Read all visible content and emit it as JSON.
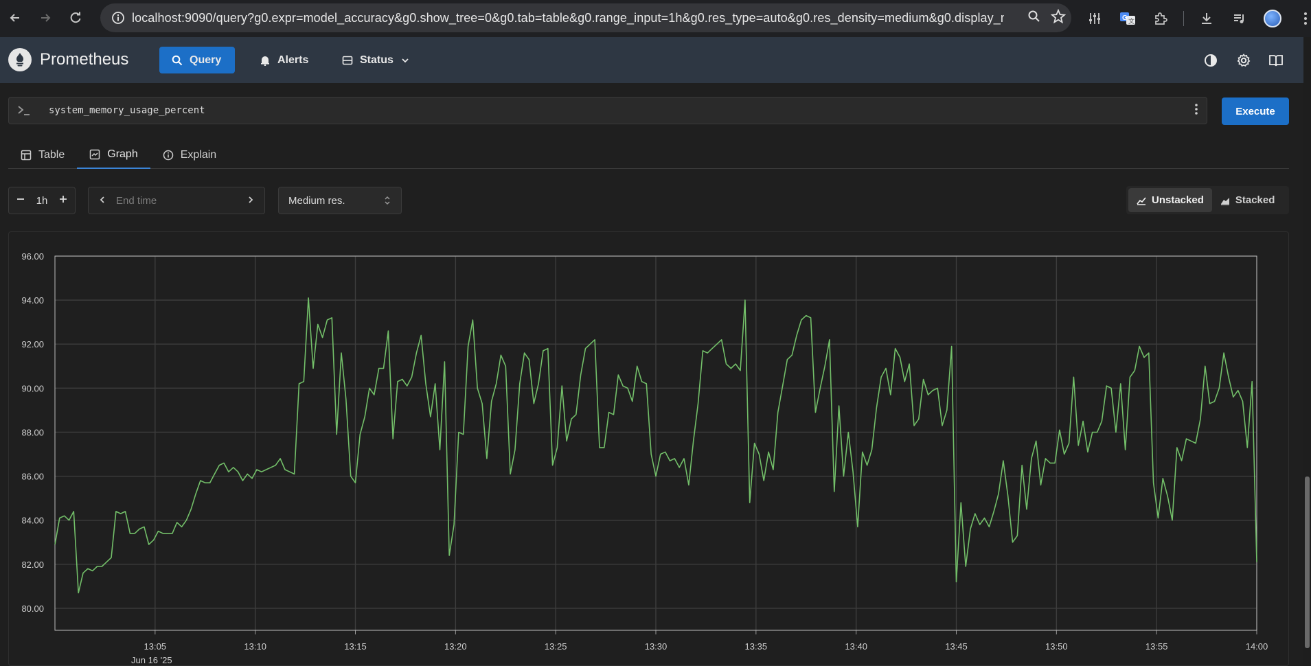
{
  "browser": {
    "url_host": "localhost",
    "url_rest": ":9090/query?g0.expr=model_accuracy&g0.show_tree=0&g0.tab=table&g0.range_input=1h&g0.res_type=auto&g0.res_density=medium&g0.display_mode..."
  },
  "app": {
    "brand": "Prometheus",
    "nav": {
      "query": "Query",
      "alerts": "Alerts",
      "status": "Status"
    }
  },
  "query": {
    "expression": "system_memory_usage_percent",
    "execute_label": "Execute"
  },
  "tabs": {
    "table": "Table",
    "graph": "Graph",
    "explain": "Explain",
    "active": "Graph"
  },
  "controls": {
    "range_value": "1h",
    "end_time_placeholder": "End time",
    "resolution": "Medium res.",
    "unstacked": "Unstacked",
    "stacked": "Stacked",
    "active_mode": "Unstacked"
  },
  "colors": {
    "accent": "#1c6fc7",
    "series": "#73bf69",
    "grid": "#3d3d3d"
  },
  "date_label": "Jun 16 '25",
  "chart_data": {
    "type": "line",
    "title": "",
    "xlabel": "",
    "ylabel": "",
    "ylim": [
      79.0,
      96.0
    ],
    "y_ticks": [
      "80.00",
      "82.00",
      "84.00",
      "86.00",
      "88.00",
      "90.00",
      "92.00",
      "94.00",
      "96.00"
    ],
    "x_ticks": [
      "13:05",
      "13:10",
      "13:15",
      "13:20",
      "13:25",
      "13:30",
      "13:35",
      "13:40",
      "13:45",
      "13:50",
      "13:55",
      "14:00"
    ],
    "x_range": [
      "13:00",
      "14:00"
    ],
    "grid": true,
    "series": [
      {
        "values": [
          82.9,
          84.1,
          84.2,
          84.0,
          84.4,
          80.7,
          81.6,
          81.8,
          81.7,
          81.9,
          81.9,
          82.1,
          82.3,
          84.4,
          84.3,
          84.4,
          83.4,
          83.4,
          83.6,
          83.7,
          82.9,
          83.1,
          83.5,
          83.4,
          83.4,
          83.4,
          83.9,
          83.7,
          84.0,
          84.5,
          85.2,
          85.8,
          85.7,
          85.7,
          86.1,
          86.5,
          86.6,
          86.2,
          86.4,
          86.2,
          85.8,
          86.1,
          85.9,
          86.3,
          86.2,
          86.3,
          86.4,
          86.5,
          86.8,
          86.3,
          86.2,
          86.1,
          90.2,
          90.3,
          94.1,
          90.9,
          92.9,
          92.3,
          93.1,
          93.2,
          87.9,
          91.6,
          89.5,
          86.0,
          85.7,
          87.9,
          88.7,
          90.0,
          89.7,
          90.9,
          90.9,
          92.6,
          87.7,
          90.3,
          90.4,
          90.1,
          90.5,
          91.6,
          92.4,
          90.2,
          88.7,
          90.2,
          87.2,
          91.2,
          82.4,
          83.8,
          88.0,
          87.9,
          91.9,
          93.1,
          90.0,
          89.3,
          86.8,
          89.4,
          90.2,
          91.5,
          91.0,
          86.1,
          87.2,
          90.2,
          91.6,
          91.3,
          89.3,
          90.2,
          91.7,
          91.8,
          86.5,
          87.3,
          90.1,
          87.6,
          88.6,
          88.8,
          90.6,
          91.8,
          92.0,
          92.2,
          87.3,
          87.3,
          88.9,
          88.8,
          90.6,
          90.1,
          90.0,
          89.4,
          91.0,
          90.3,
          90.2,
          87.0,
          86.0,
          87.0,
          87.1,
          86.7,
          86.8,
          86.4,
          86.8,
          85.6,
          87.6,
          89.3,
          91.7,
          91.6,
          91.8,
          92.0,
          92.2,
          91.1,
          90.9,
          91.1,
          90.8,
          94.0,
          84.8,
          87.5,
          87.0,
          85.8,
          87.1,
          86.3,
          88.9,
          90.1,
          91.3,
          91.5,
          92.4,
          93.1,
          93.3,
          93.2,
          88.9,
          90.0,
          91.0,
          92.2,
          85.3,
          89.2,
          86.0,
          88.0,
          86.2,
          83.7,
          87.1,
          86.5,
          87.2,
          89.1,
          90.5,
          90.9,
          89.7,
          91.8,
          91.4,
          90.3,
          91.1,
          88.3,
          88.6,
          90.4,
          89.7,
          89.9,
          90.0,
          88.3,
          89.0,
          91.9,
          81.2,
          84.8,
          81.9,
          83.6,
          84.3,
          83.8,
          84.1,
          83.7,
          84.4,
          85.2,
          86.7,
          85.1,
          83.0,
          83.3,
          86.5,
          84.5,
          86.8,
          87.6,
          85.6,
          86.8,
          86.6,
          86.6,
          88.1,
          87.0,
          87.5,
          90.5,
          87.4,
          88.5,
          87.1,
          88.0,
          88.0,
          88.5,
          90.1,
          90.0,
          88.0,
          90.2,
          87.2,
          90.5,
          90.8,
          91.9,
          91.4,
          91.6,
          85.7,
          84.1,
          85.9,
          85.1,
          84.0,
          87.3,
          86.7,
          87.7,
          87.6,
          87.5,
          88.6,
          91.0,
          89.3,
          89.4,
          90.0,
          91.6,
          90.5,
          89.6,
          89.9,
          89.4,
          87.3,
          90.3,
          82.1
        ]
      }
    ]
  }
}
